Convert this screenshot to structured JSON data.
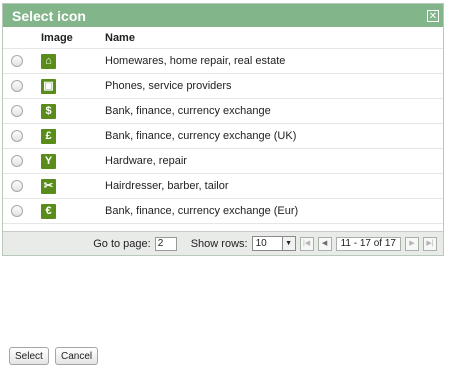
{
  "dialog": {
    "title": "Select icon",
    "close_icon": "close-icon",
    "columns": {
      "image": "Image",
      "name": "Name"
    },
    "rows": [
      {
        "glyph": "⌂",
        "icon": "house-icon",
        "name": "Homewares, home repair, real estate"
      },
      {
        "glyph": "▣",
        "icon": "phone-icon",
        "name": "Phones, service providers"
      },
      {
        "glyph": "$",
        "icon": "dollar-icon",
        "name": "Bank, finance, currency exchange"
      },
      {
        "glyph": "£",
        "icon": "pound-icon",
        "name": "Bank, finance, currency exchange (UK)"
      },
      {
        "glyph": "Y",
        "icon": "wrench-icon",
        "name": "Hardware, repair"
      },
      {
        "glyph": "✂",
        "icon": "scissors-icon",
        "name": "Hairdresser, barber, tailor"
      },
      {
        "glyph": "€",
        "icon": "euro-icon",
        "name": "Bank, finance, currency exchange (Eur)"
      }
    ],
    "icon_color": "#5a8c1c",
    "title_color": "#82b58a"
  },
  "pager": {
    "go_to_label": "Go to page:",
    "page_value": "2",
    "show_rows_label": "Show rows:",
    "rows_value": "10",
    "range_text": "11 - 17 of 17"
  },
  "buttons": {
    "select": "Select",
    "cancel": "Cancel"
  }
}
